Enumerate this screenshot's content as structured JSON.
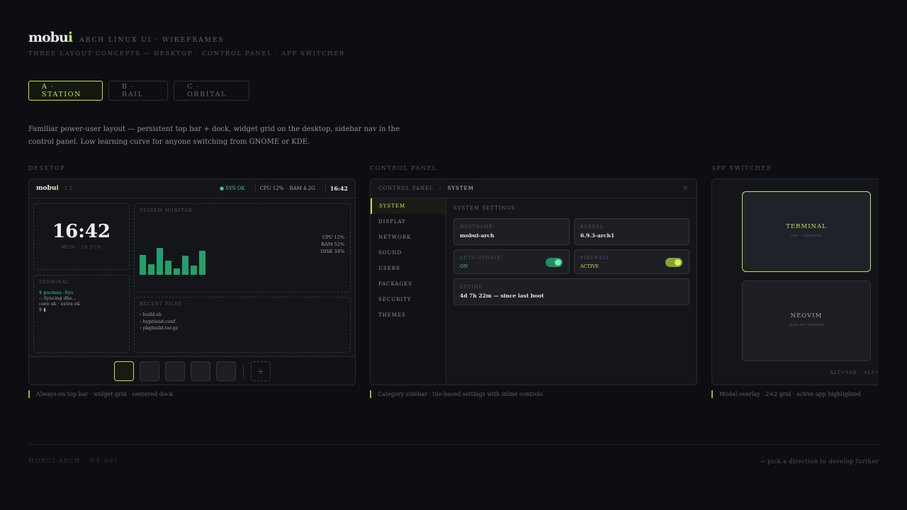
{
  "header": {
    "logo_main": "mobu",
    "logo_accent": "i",
    "brand_sub": "ARCH LINUX UI · WIREFRAMES",
    "subtitle": "THREE LAYOUT CONCEPTS — DESKTOP · CONTROL PANEL · APP SWITCHER"
  },
  "tabs": [
    {
      "label": "A · STATION",
      "active": true
    },
    {
      "label": "B · RAIL",
      "active": false
    },
    {
      "label": "C · ORBITAL",
      "active": false
    }
  ],
  "description": "Familiar power-user layout — persistent top bar + dock, widget grid on the desktop, sidebar nav in the control panel. Low learning curve for anyone switching from GNOME or KDE.",
  "sections": {
    "desktop": "DESKTOP",
    "control_panel": "CONTROL PANEL",
    "app_switcher": "APP SWITCHER"
  },
  "desktop": {
    "topbar": {
      "logo_main": "mobu",
      "logo_accent": "i",
      "workspace": "1 2",
      "sys_ok": "● SYS OK",
      "cpu": "CPU 12%",
      "ram": "RAM 4.2G",
      "clock": "16:42"
    },
    "clock_widget": {
      "time": "16:42",
      "date": "MON · 16 JUN"
    },
    "monitor_widget": {
      "label": "SYSTEM MONITOR",
      "bars": [
        0.7,
        0.38,
        0.95,
        0.5,
        0.22,
        0.68,
        0.32,
        0.85
      ],
      "stats": [
        "CPU 12%",
        "RAM 52%",
        "DISK 34%"
      ]
    },
    "terminal_widget": {
      "label": "TERMINAL",
      "command": "$ pacman -Syu",
      "lines": [
        ":: Syncing dbs...",
        "core ok · extra ok",
        "$ ▮"
      ]
    },
    "files_widget": {
      "label": "RECENT FILES",
      "files": [
        "› build.sh",
        "› hyprland.conf",
        "› pkgbuild.tar.gz"
      ]
    },
    "dock_add": "+"
  },
  "control_panel": {
    "breadcrumb_root": "CONTROL PANEL",
    "breadcrumb_sep": "›",
    "breadcrumb_current": "SYSTEM",
    "close": "×",
    "nav": [
      {
        "label": "SYSTEM",
        "active": true
      },
      {
        "label": "DISPLAY",
        "active": false
      },
      {
        "label": "NETWORK",
        "active": false
      },
      {
        "label": "SOUND",
        "active": false
      },
      {
        "label": "USERS",
        "active": false
      },
      {
        "label": "PACKAGES",
        "active": false
      },
      {
        "label": "SECURITY",
        "active": false
      },
      {
        "label": "THEMES",
        "active": false
      }
    ],
    "title": "SYSTEM SETTINGS",
    "tiles": {
      "hostname": {
        "label": "HOSTNAME",
        "value": "mobui-arch"
      },
      "kernel": {
        "label": "KERNEL",
        "value": "6.9.3-arch1"
      },
      "auto_update": {
        "label": "AUTO-UPDATE",
        "value": "ON"
      },
      "firewall": {
        "label": "FIREWALL",
        "value": "ACTIVE"
      },
      "uptime": {
        "label": "UPTIME",
        "value": "4d 7h 22m — since last boot"
      }
    }
  },
  "app_switcher": {
    "apps": [
      {
        "name": "TERMINAL",
        "sub": "zsh · ~/projects",
        "active": true
      },
      {
        "name": "NEOVIM",
        "sub": "main.rs · unsaved",
        "active": false
      }
    ],
    "hint": "ALT+TAB · ALT+SHIFT+TAB"
  },
  "captions": {
    "desktop": "Always-on top bar · widget grid · centered dock",
    "control_panel": "Category sidebar · tile-based settings with inline controls",
    "app_switcher": "Modal overlay · 2×2 grid · active app highlighted"
  },
  "footer": {
    "left": "MOBUI ARCH · WF-001",
    "right": "→ pick a direction to develop further"
  },
  "colors": {
    "accent": "#c6e24a",
    "background": "#0d0e11",
    "ok_green": "#3ecf8e",
    "bar_green": "#22a06b"
  }
}
